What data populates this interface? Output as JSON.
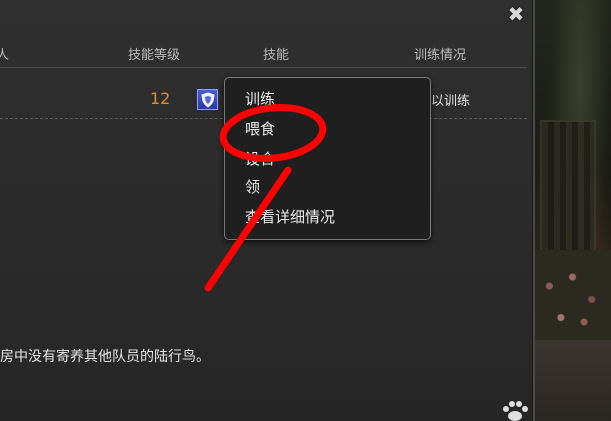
{
  "header": {
    "partial_col_label": "人",
    "skill_level_label": "技能等级",
    "skill_label": "技能",
    "training_status_label": "训练情况"
  },
  "row": {
    "skill_level": "12",
    "skill_icon": "shield-icon",
    "training_status_partial": "以训练"
  },
  "context_menu": {
    "items": [
      {
        "label": "训练"
      },
      {
        "label": "喂食"
      },
      {
        "label": "设合"
      },
      {
        "label": "领"
      },
      {
        "label": "查看详细情况"
      }
    ]
  },
  "message": "房中没有寄养其他队员的陆行鸟。",
  "icons": {
    "close": "close-icon",
    "paw": "paw-icon"
  },
  "colors": {
    "level_orange": "#e48b2c",
    "annotation_red": "#ff0000",
    "skill_icon_blue": "#3a4cc4"
  }
}
